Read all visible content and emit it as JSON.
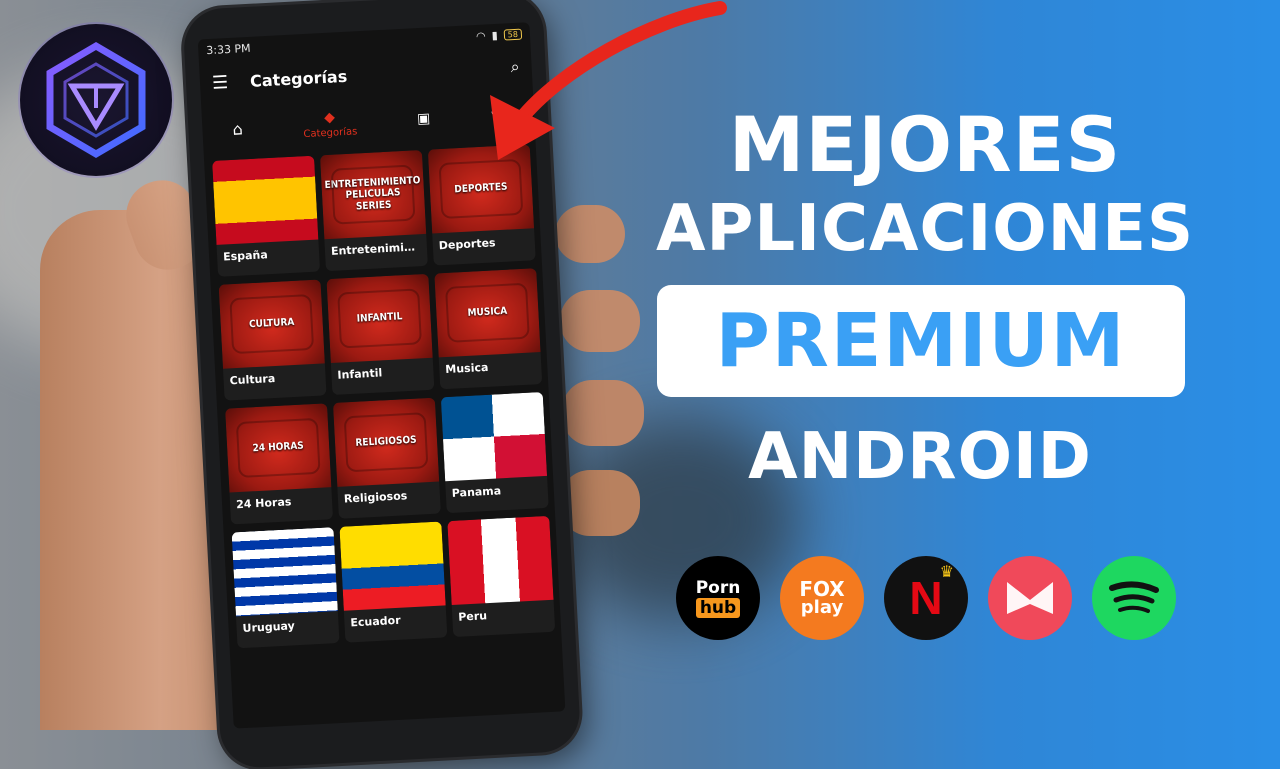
{
  "status_bar": {
    "time": "3:33 PM",
    "battery": "58"
  },
  "app_bar": {
    "title": "Categorías"
  },
  "tabs": [
    {
      "icon": "home-icon",
      "label": ""
    },
    {
      "icon": "layers-icon",
      "label": "Categorías",
      "active": true
    },
    {
      "icon": "tv-icon",
      "label": ""
    },
    {
      "icon": "heart-icon",
      "label": ""
    }
  ],
  "categories": [
    {
      "name": "España",
      "thumb_type": "flag-spain",
      "thumb_text": ""
    },
    {
      "name": "Entretenimie…",
      "thumb_type": "tv",
      "thumb_text": "ENTRETENIMIENTO\nPELICULAS\nSERIES"
    },
    {
      "name": "Deportes",
      "thumb_type": "tv",
      "thumb_text": "DEPORTES"
    },
    {
      "name": "Cultura",
      "thumb_type": "tv",
      "thumb_text": "CULTURA"
    },
    {
      "name": "Infantil",
      "thumb_type": "tv",
      "thumb_text": "INFANTIL"
    },
    {
      "name": "Musica",
      "thumb_type": "tv",
      "thumb_text": "MUSICA"
    },
    {
      "name": "24 Horas",
      "thumb_type": "tv",
      "thumb_text": "24 HORAS"
    },
    {
      "name": "Religiosos",
      "thumb_type": "tv",
      "thumb_text": "RELIGIOSOS"
    },
    {
      "name": "Panama",
      "thumb_type": "flag-panama",
      "thumb_text": ""
    },
    {
      "name": "Uruguay",
      "thumb_type": "flag-uruguay",
      "thumb_text": ""
    },
    {
      "name": "Ecuador",
      "thumb_type": "flag-ecuador",
      "thumb_text": ""
    },
    {
      "name": "Peru",
      "thumb_type": "flag-peru",
      "thumb_text": ""
    }
  ],
  "headline": {
    "line1": "MEJORES",
    "line2": "APLICACIONES",
    "premium": "PREMIUM",
    "line4": "ANDROID"
  },
  "app_icons": [
    {
      "name": "pornhub",
      "line1": "Porn",
      "line2": "hub",
      "bg": "#000000"
    },
    {
      "name": "foxplay",
      "line1": "FOX",
      "line2": "play",
      "bg": "#f47a1f"
    },
    {
      "name": "netflix",
      "line1": "N",
      "line2": "",
      "bg": "#111111"
    },
    {
      "name": "musixmatch",
      "line1": "",
      "line2": "",
      "bg": "#f0495a"
    },
    {
      "name": "spotify",
      "line1": "",
      "line2": "",
      "bg": "#1ed760"
    }
  ],
  "colors": {
    "accent_red": "#e0301e",
    "premium_blue": "#3aa0f5"
  }
}
